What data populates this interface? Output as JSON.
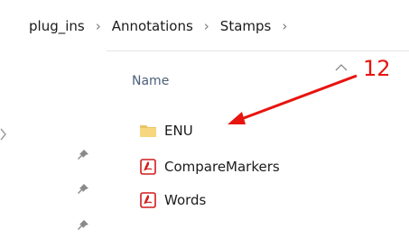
{
  "breadcrumb": {
    "items": [
      {
        "label": "plug_ins"
      },
      {
        "label": "Annotations"
      },
      {
        "label": "Stamps"
      }
    ],
    "separator": "›"
  },
  "columns": {
    "name_header": "Name"
  },
  "files": [
    {
      "name": "ENU",
      "icon": "folder-icon"
    },
    {
      "name": "CompareMarkers",
      "icon": "pdf-file-icon"
    },
    {
      "name": "Words",
      "icon": "pdf-file-icon"
    }
  ],
  "annotation": {
    "number": "12",
    "color": "#e8140f"
  }
}
